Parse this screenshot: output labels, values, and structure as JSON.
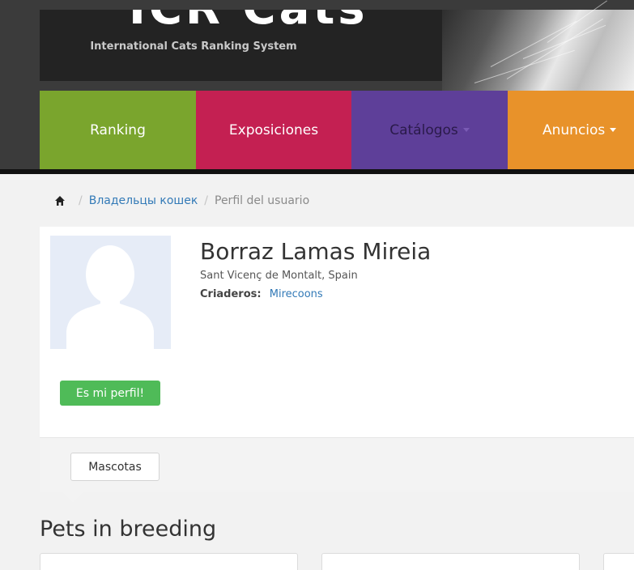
{
  "header": {
    "logo_text": "ICR Cats",
    "subtitle": "International Cats Ranking System"
  },
  "nav": {
    "items": [
      {
        "label": "Ranking",
        "color": "#7aa52d",
        "dropdown": false
      },
      {
        "label": "Exposiciones",
        "color": "#c42052",
        "dropdown": false
      },
      {
        "label": "Catálogos",
        "color": "#5e3f99",
        "dropdown": true
      },
      {
        "label": "Anuncios",
        "color": "#e8922a",
        "dropdown": true
      }
    ]
  },
  "breadcrumb": {
    "home_icon": "home-icon",
    "link": "Владельцы кошек",
    "current": "Perfil del usuario"
  },
  "profile": {
    "name": "Borraz Lamas Mireia",
    "location": "Sant Vicenç de Montalt, Spain",
    "breeder_label": "Criaderos:",
    "breeder_value": "Mirecoons",
    "avatar_icon": "user-silhouette-icon",
    "mine_button": "Es mi perfil!",
    "mine_button_color": "#4fbb58"
  },
  "tabs": {
    "active": "Mascotas"
  },
  "section": {
    "title": "Pets in breeding"
  }
}
